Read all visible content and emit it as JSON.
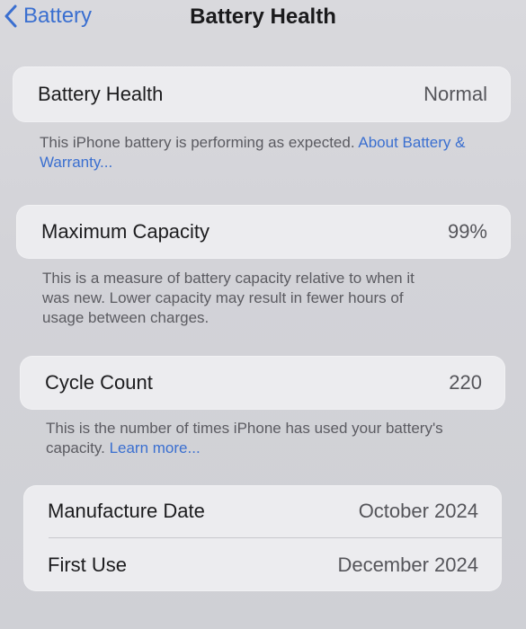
{
  "nav": {
    "back_label": "Battery",
    "title": "Battery Health"
  },
  "battery_health": {
    "label": "Battery Health",
    "value": "Normal",
    "footnote": "This iPhone battery is performing as expected.",
    "link": "About Battery & Warranty..."
  },
  "maximum_capacity": {
    "label": "Maximum Capacity",
    "value": "99%",
    "footnote_line1": "This is a measure of battery capacity relative to when it",
    "footnote_line2": "was new. Lower capacity may result in fewer hours of",
    "footnote_line3": "usage between charges."
  },
  "cycle_count": {
    "label": "Cycle Count",
    "value": "220",
    "footnote_line1": "This is the number of times iPhone has used your battery's",
    "footnote_line2": "capacity.",
    "link": "Learn more..."
  },
  "dates": {
    "manufacture_label": "Manufacture Date",
    "manufacture_value": "October 2024",
    "first_use_label": "First Use",
    "first_use_value": "December 2024"
  },
  "colors": {
    "accent": "#3a6fd0",
    "card": "#ececef",
    "background": "#d6d6db"
  }
}
